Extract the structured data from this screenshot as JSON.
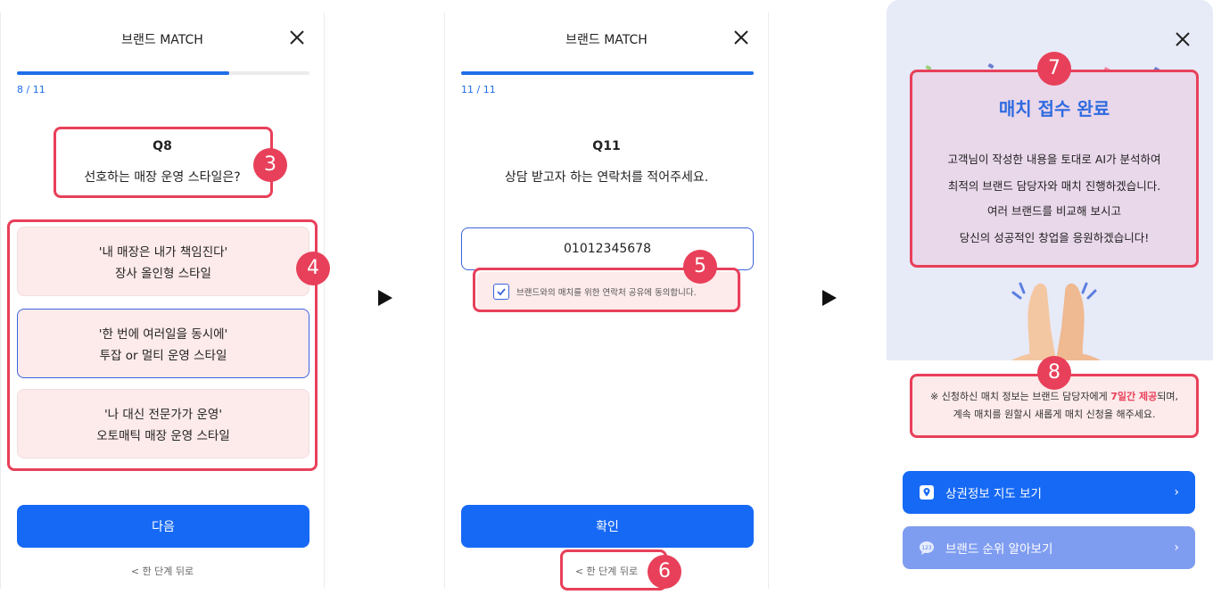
{
  "colors": {
    "accent": "#1669f5",
    "highlight": "#e8405a",
    "progress": "#1f6ee8"
  },
  "screen1": {
    "header_title": "브랜드 MATCH",
    "progress": 0.727,
    "step": "8 / 11",
    "question_code": "Q8",
    "question_text": "선호하는 매장 운영 스타일은?",
    "options": [
      {
        "line1": "'내 매장은 내가 책임진다'",
        "line2": "장사 올인형 스타일",
        "selected": false
      },
      {
        "line1": "'한 번에 여러일을 동시에'",
        "line2": "투잡 or 멀티 운영 스타일",
        "selected": true
      },
      {
        "line1": "'나 대신 전문가가 운영'",
        "line2": "오토매틱 매장 운영 스타일",
        "selected": false
      }
    ],
    "next_label": "다음",
    "back_label": "< 한 단계 뒤로",
    "badges": [
      "3",
      "4"
    ]
  },
  "screen2": {
    "header_title": "브랜드 MATCH",
    "progress": 1.0,
    "step": "11 / 11",
    "question_code": "Q11",
    "question_text": "상담 받고자 하는 연락처를 적어주세요.",
    "phone_value": "01012345678",
    "consent_text": "브랜드와의 매치를 위한 연락처 공유에 동의합니다.",
    "consent_checked": true,
    "confirm_label": "확인",
    "back_label": "< 한 단계 뒤로",
    "badges": [
      "5",
      "6"
    ]
  },
  "screen3": {
    "title": "매치 접수 완료",
    "lines": [
      "고객님이 작성한 내용을 토대로 AI가 분석하여",
      "최적의 브랜드 담당자와 매치 진행하겠습니다.",
      "여러 브랜드를 비교해 보시고",
      "당신의 성공적인 창업을 응원하겠습니다!"
    ],
    "notice_pre": "※ 신청하신 매치 정보는 브랜드 담당자에게 ",
    "notice_red": "7일간 제공",
    "notice_post": "되며,",
    "notice_line2": "계속 매치를 원할시 새롭게 매치 신청을 해주세요.",
    "cta1": {
      "label": "상권정보 지도 보기",
      "icon": "map-pin-icon",
      "color": "#1669f5"
    },
    "cta2": {
      "label": "브랜드 순위 알아보기",
      "icon": "chat-icon",
      "color": "#7f9df0"
    },
    "badges": [
      "7",
      "8"
    ]
  }
}
